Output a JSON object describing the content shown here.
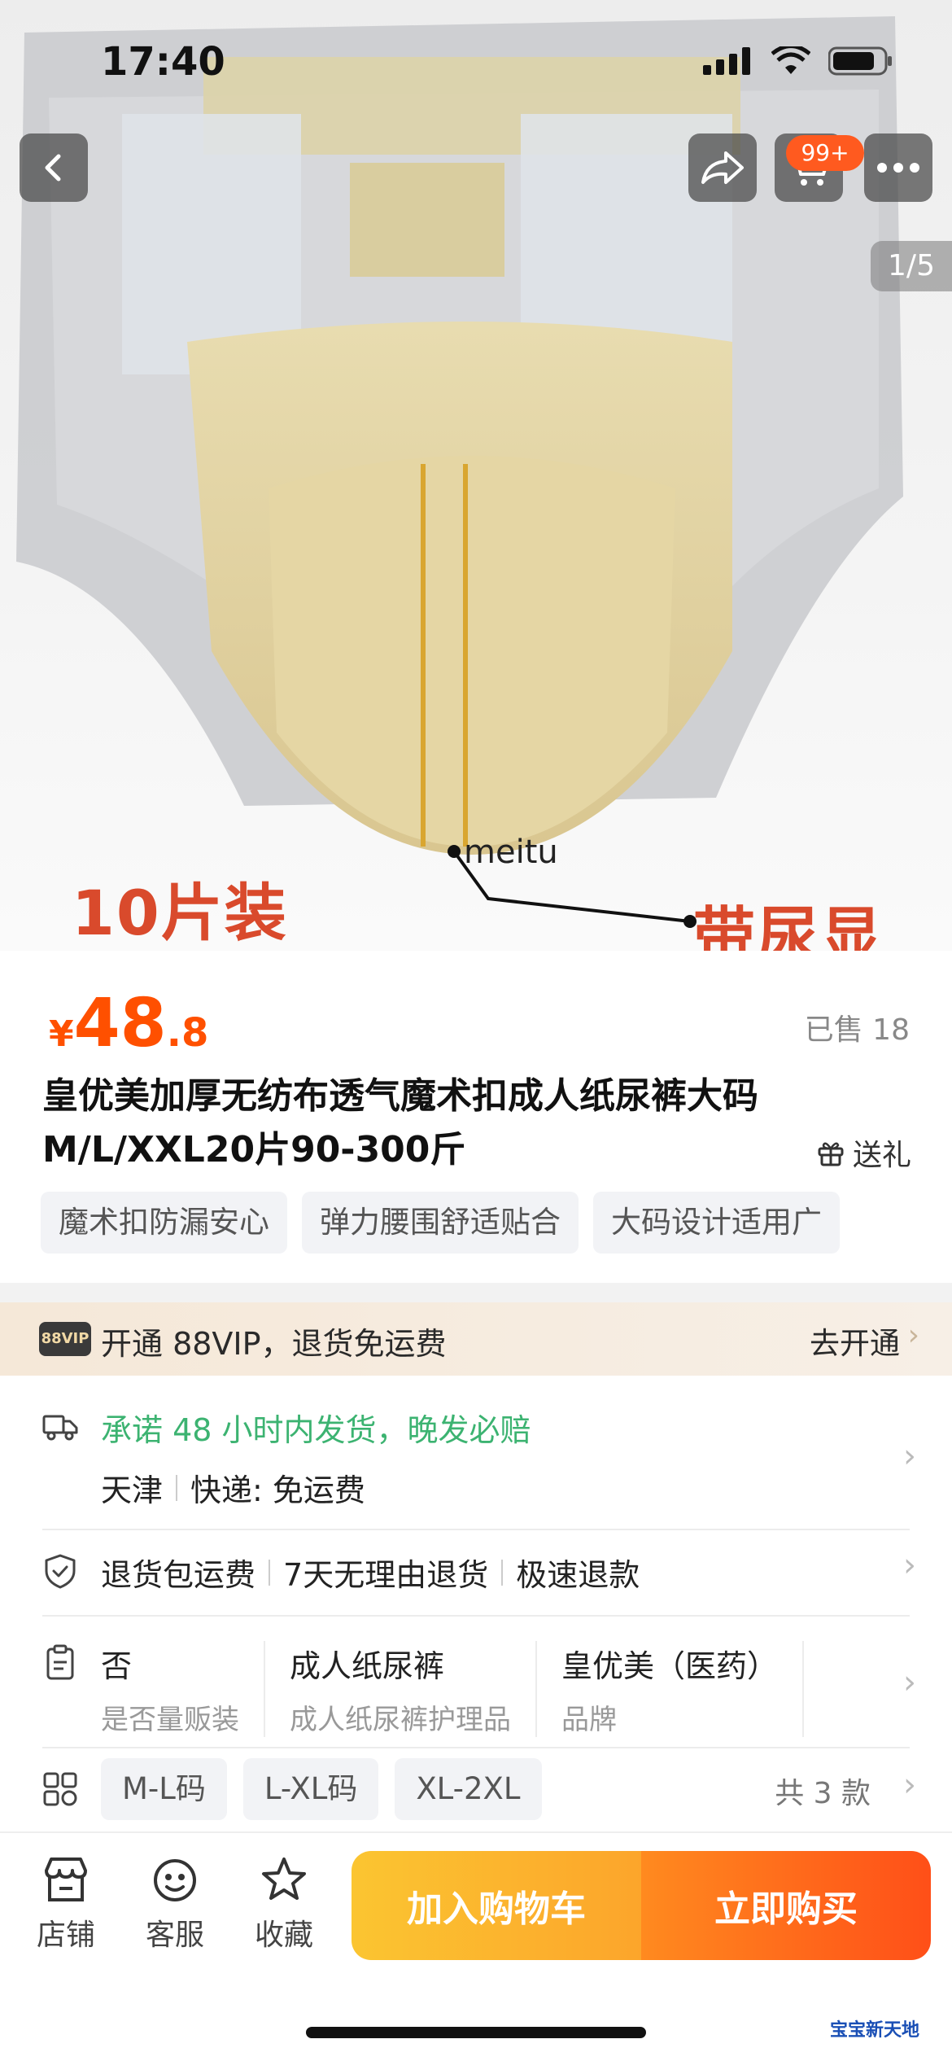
{
  "status_bar": {
    "time": "17:40"
  },
  "hero": {
    "cart_badge": "99+",
    "image_counter": "1/5",
    "left_overlay": "10片装",
    "right_overlay": "带尿显",
    "watermark": "meitu"
  },
  "product": {
    "price_currency": "¥",
    "price_integer": "48",
    "price_decimal": ".8",
    "sold": "已售 18",
    "title": "皇优美加厚无纺布透气魔术扣成人纸尿裤大码M/L/XXL20片90-300斤",
    "gift_label": "送礼",
    "tags": [
      "魔术扣防漏安心",
      "弹力腰围舒适贴合",
      "大码设计适用广"
    ]
  },
  "vip": {
    "logo": "88VIP",
    "text": "开通 88VIP，退货免运费",
    "action": "去开通"
  },
  "shipping": {
    "promise": "承诺 48 小时内发货，晚发必赔",
    "origin": "天津",
    "delivery": "快递: 免运费"
  },
  "returns": [
    "退货包运费",
    "7天无理由退货",
    "极速退款"
  ],
  "params": [
    {
      "value": "否",
      "key": "是否量贩装"
    },
    {
      "value": "成人纸尿裤",
      "key": "成人纸尿裤护理品"
    },
    {
      "value": "皇优美（医药）",
      "key": "品牌"
    }
  ],
  "skus": {
    "options": [
      "M-L码",
      "L-XL码",
      "XL-2XL"
    ],
    "count": "共 3 款"
  },
  "bottom_bar": {
    "store": "店铺",
    "service": "客服",
    "favorite": "收藏",
    "add_to_cart": "加入购物车",
    "buy_now": "立即购买"
  },
  "corner_logo": "宝宝新天地",
  "colors": {
    "price": "#ff5000",
    "promise_green": "#3cb371",
    "overlay_red": "#d94a2c"
  }
}
